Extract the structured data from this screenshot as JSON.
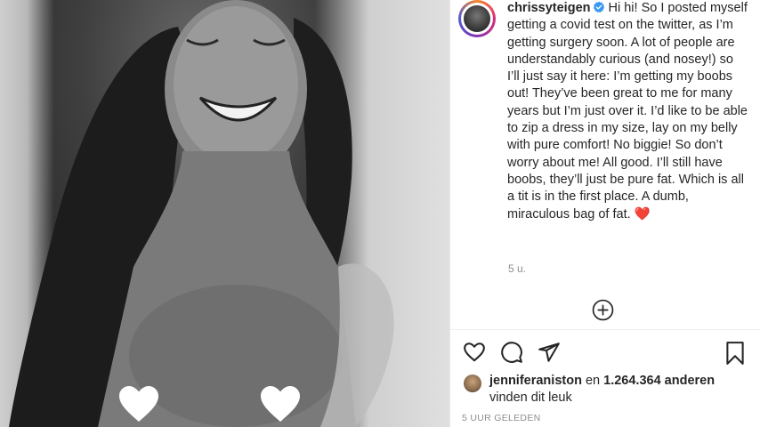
{
  "post": {
    "username": "chrissyteigen",
    "caption": "Hi hi! So I posted myself getting a covid test on the twitter, as I’m getting surgery soon. A lot of people are understandably curious (and nosey!) so I’ll just say it here: I’m getting my boobs out! They’ve been great to me for many years but I’m just over it. I’d like to be able to zip a dress in my size, lay on my belly with pure comfort! No biggie! So don’t worry about me! All good. I’ll still have boobs, they’ll just be pure fat. Which is all a tit is in the first place. A dumb, miraculous bag of fat. ❤️",
    "caption_time": "5 u.",
    "posted_time": "5 UUR GELEDEN"
  },
  "likes": {
    "user": "jenniferaniston",
    "connector": "en",
    "count": "1.264.364 anderen",
    "suffix": "vinden dit leuk"
  },
  "icons": {
    "verified": "verified-badge-icon",
    "add": "add-circle-icon",
    "like": "heart-outline-icon",
    "comment": "comment-bubble-icon",
    "share": "paper-plane-icon",
    "save": "bookmark-icon",
    "photo_hearts": "heart-icon"
  },
  "colors": {
    "verified": "#3897f0",
    "text": "#262626",
    "muted": "#8e8e8e"
  }
}
